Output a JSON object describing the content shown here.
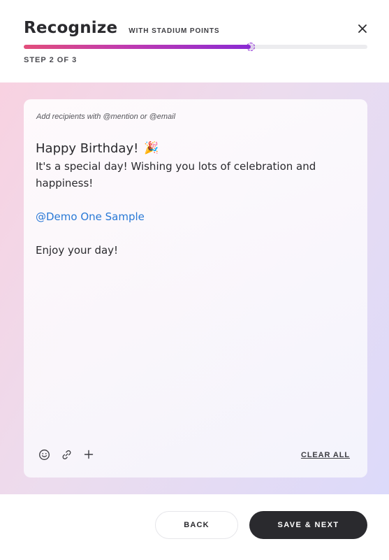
{
  "header": {
    "title": "Recognize",
    "subtitle": "WITH STADIUM POINTS",
    "step_label": "STEP 2 OF 3",
    "close_icon": "close-icon"
  },
  "progress": {
    "fraction": 0.66,
    "color_start": "#e24e7b",
    "color_end": "#8a2bd3"
  },
  "editor": {
    "placeholder": "Add recipients with @mention or @email",
    "message_title": "Happy Birthday!",
    "message_title_emoji": "🎉",
    "body_line_1": "It's a special day! Wishing you lots of celebration and",
    "body_line_2": "happiness!",
    "mention": "@Demo One Sample",
    "closing": "Enjoy your day!",
    "mention_color": "#2979d6"
  },
  "toolbar": {
    "icons": [
      "emoji-icon",
      "link-icon",
      "plus-icon"
    ],
    "clear_all_label": "CLEAR ALL"
  },
  "footer": {
    "back_label": "BACK",
    "next_label": "SAVE & NEXT"
  }
}
